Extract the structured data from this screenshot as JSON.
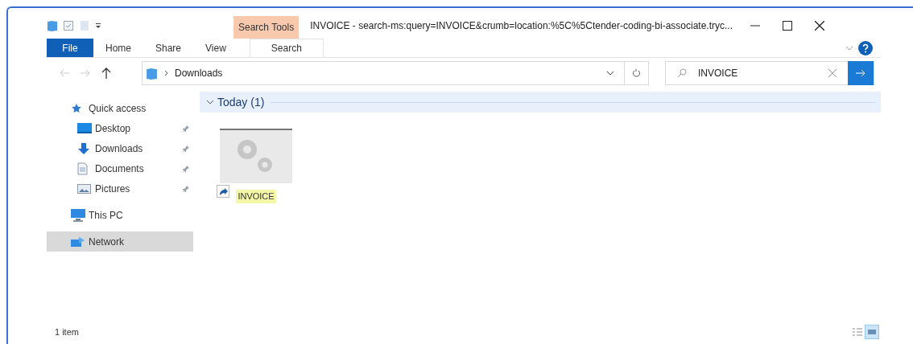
{
  "window": {
    "title": "INVOICE - search-ms:query=INVOICE&crumb=location:%5C%5Ctender-coding-bi-associate.tryc..."
  },
  "contextual_tab": {
    "label": "Search Tools"
  },
  "ribbon_tabs": [
    {
      "label": "File",
      "kind": "file",
      "selected": false
    },
    {
      "label": "Home",
      "kind": "tab",
      "selected": false
    },
    {
      "label": "Share",
      "kind": "tab",
      "selected": false
    },
    {
      "label": "View",
      "kind": "tab",
      "selected": false
    },
    {
      "label": "Search",
      "kind": "tab",
      "selected": true
    }
  ],
  "address": {
    "crumbs": [
      "Downloads"
    ]
  },
  "search": {
    "value": "INVOICE"
  },
  "sidebar": {
    "items": [
      {
        "label": "Quick access",
        "kind": "star",
        "selected": false,
        "children": [
          {
            "label": "Desktop",
            "kind": "desktop",
            "selected": false,
            "pinned": true
          },
          {
            "label": "Downloads",
            "kind": "downloads",
            "selected": false,
            "pinned": true
          },
          {
            "label": "Documents",
            "kind": "documents",
            "selected": false,
            "pinned": true
          },
          {
            "label": "Pictures",
            "kind": "pictures",
            "selected": false,
            "pinned": true
          }
        ]
      },
      {
        "label": "This PC",
        "kind": "pc",
        "selected": false
      },
      {
        "label": "Network",
        "kind": "network",
        "selected": true
      }
    ]
  },
  "groups": [
    {
      "header": "Today (1)",
      "expanded": true,
      "files": [
        {
          "name": "INVOICE",
          "highlighted": true,
          "shortcut": true
        }
      ]
    }
  ],
  "status_bar": {
    "text": "1 item"
  },
  "view_buttons": [
    {
      "kind": "details",
      "selected": false
    },
    {
      "kind": "large-icons",
      "selected": true
    }
  ]
}
